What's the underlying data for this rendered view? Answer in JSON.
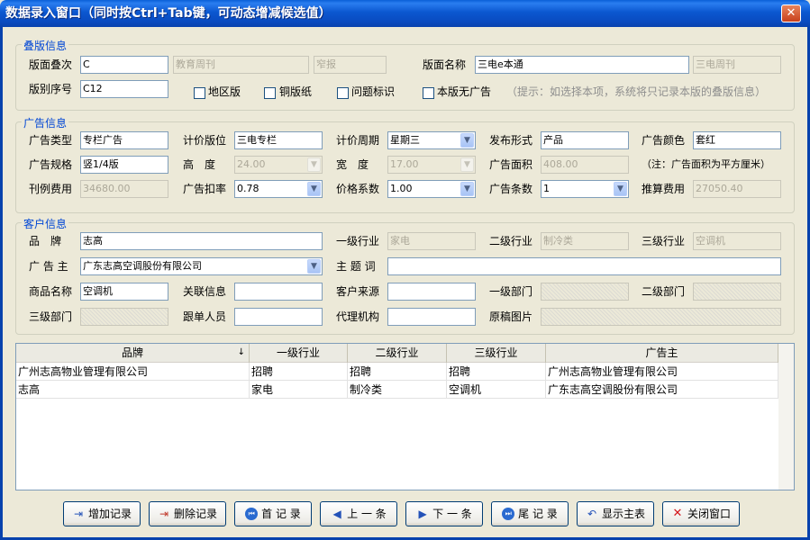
{
  "window": {
    "title": "数据录入窗口（同时按Ctrl+Tab键，可动态增减候选值）",
    "close_glyph": "✕"
  },
  "layout": {
    "section_titles": {
      "layout": "叠版信息",
      "ad": "广告信息",
      "client": "客户信息"
    }
  },
  "layout_info": {
    "edition_label": "版面叠次",
    "edition_value": "C",
    "edition_extra1": "教育周刊",
    "edition_extra2": "窄报",
    "page_name_label": "版面名称",
    "page_name_value": "三电e本通",
    "page_name_extra": "三电周刊",
    "page_no_label": "版别序号",
    "page_no_value": "C12",
    "chk_region": "地区版",
    "chk_copper": "铜版纸",
    "chk_issue": "问题标识",
    "chk_no_ad": "本版无广告",
    "hint": "（提示：如选择本项，系统将只记录本版的叠版信息）"
  },
  "ad_info": {
    "type_label": "广告类型",
    "type_value": "专栏广告",
    "price_slot_label": "计价版位",
    "price_slot_value": "三电专栏",
    "price_cycle_label": "计价周期",
    "price_cycle_value": "星期三",
    "publish_form_label": "发布形式",
    "publish_form_value": "产品",
    "color_label": "广告颜色",
    "color_value": "套红",
    "spec_label": "广告规格",
    "spec_value": "竖1/4版",
    "height_label": "高　度",
    "height_value": "24.00",
    "width_label": "宽　度",
    "width_value": "17.00",
    "area_label": "广告面积",
    "area_value": "408.00",
    "area_note": "（注：广告面积为平方厘米）",
    "fee_label": "刊例费用",
    "fee_value": "34680.00",
    "discount_label": "广告扣率",
    "discount_value": "0.78",
    "coef_label": "价格系数",
    "coef_value": "1.00",
    "count_label": "广告条数",
    "count_value": "1",
    "est_fee_label": "推算费用",
    "est_fee_value": "27050.40"
  },
  "client_info": {
    "brand_label": "品　牌",
    "brand_value": "志高",
    "ind1_label": "一级行业",
    "ind1_value": "家电",
    "ind2_label": "二级行业",
    "ind2_value": "制冷类",
    "ind3_label": "三级行业",
    "ind3_value": "空调机",
    "advertiser_label": "广 告 主",
    "advertiser_value": "广东志高空调股份有限公司",
    "topic_label": "主 题 词",
    "topic_value": "",
    "product_label": "商品名称",
    "product_value": "空调机",
    "related_label": "关联信息",
    "related_value": "",
    "source_label": "客户来源",
    "source_value": "",
    "dept1_label": "一级部门",
    "dept1_value": "",
    "dept2_label": "二级部门",
    "dept2_value": "",
    "dept3_label": "三级部门",
    "dept3_value": "",
    "follower_label": "跟单人员",
    "follower_value": "",
    "agency_label": "代理机构",
    "agency_value": "",
    "original_label": "原稿图片",
    "original_value": ""
  },
  "table": {
    "columns": [
      "品牌",
      "一级行业",
      "二级行业",
      "三级行业",
      "广告主"
    ],
    "sort_glyph": "↓",
    "rows": [
      [
        "广州志高物业管理有限公司",
        "招聘",
        "招聘",
        "招聘",
        "广州志高物业管理有限公司"
      ],
      [
        "志高",
        "家电",
        "制冷类",
        "空调机",
        "广东志高空调股份有限公司"
      ]
    ]
  },
  "buttons": {
    "add": "增加记录",
    "delete": "删除记录",
    "first": "首 记 录",
    "prev": "上 一 条",
    "next": "下 一 条",
    "last": "尾 记 录",
    "show_main": "显示主表",
    "close": "关闭窗口"
  },
  "combo_arrow": "▼"
}
